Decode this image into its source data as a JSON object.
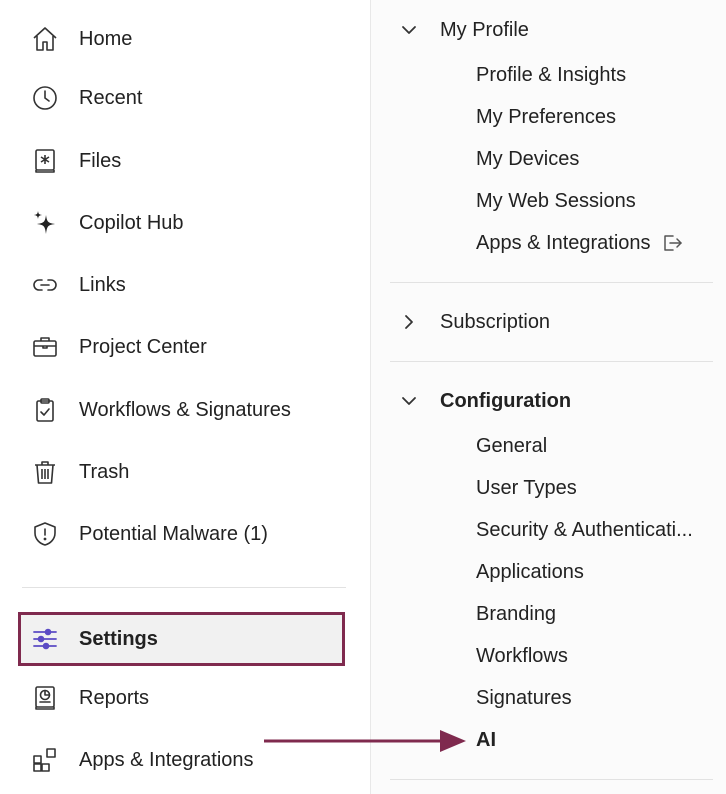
{
  "sidebar": {
    "items": [
      {
        "label": "Home",
        "icon": "home-icon"
      },
      {
        "label": "Recent",
        "icon": "clock-icon"
      },
      {
        "label": "Files",
        "icon": "files-icon"
      },
      {
        "label": "Copilot Hub",
        "icon": "sparkle-icon"
      },
      {
        "label": "Links",
        "icon": "link-icon"
      },
      {
        "label": "Project Center",
        "icon": "briefcase-icon"
      },
      {
        "label": "Workflows & Signatures",
        "icon": "clipboard-check-icon"
      },
      {
        "label": "Trash",
        "icon": "trash-icon"
      },
      {
        "label": "Potential Malware (1)",
        "icon": "shield-alert-icon"
      }
    ],
    "bottom_items": [
      {
        "label": "Settings",
        "icon": "sliders-icon",
        "active": true
      },
      {
        "label": "Reports",
        "icon": "report-icon"
      },
      {
        "label": "Apps & Integrations",
        "icon": "apps-icon"
      }
    ]
  },
  "settings_menu": {
    "my_profile": {
      "label": "My Profile",
      "expanded": true,
      "items": [
        "Profile & Insights",
        "My Preferences",
        "My Devices",
        "My Web Sessions",
        "Apps & Integrations"
      ]
    },
    "subscription": {
      "label": "Subscription",
      "expanded": false
    },
    "configuration": {
      "label": "Configuration",
      "expanded": true,
      "items": [
        "General",
        "User Types",
        "Security & Authenticati...",
        "Applications",
        "Branding",
        "Workflows",
        "Signatures",
        "AI"
      ]
    }
  },
  "colors": {
    "highlight_border": "#7f2a4e",
    "arrow": "#7f2a4e",
    "settings_icon": "#5b4bc4"
  }
}
